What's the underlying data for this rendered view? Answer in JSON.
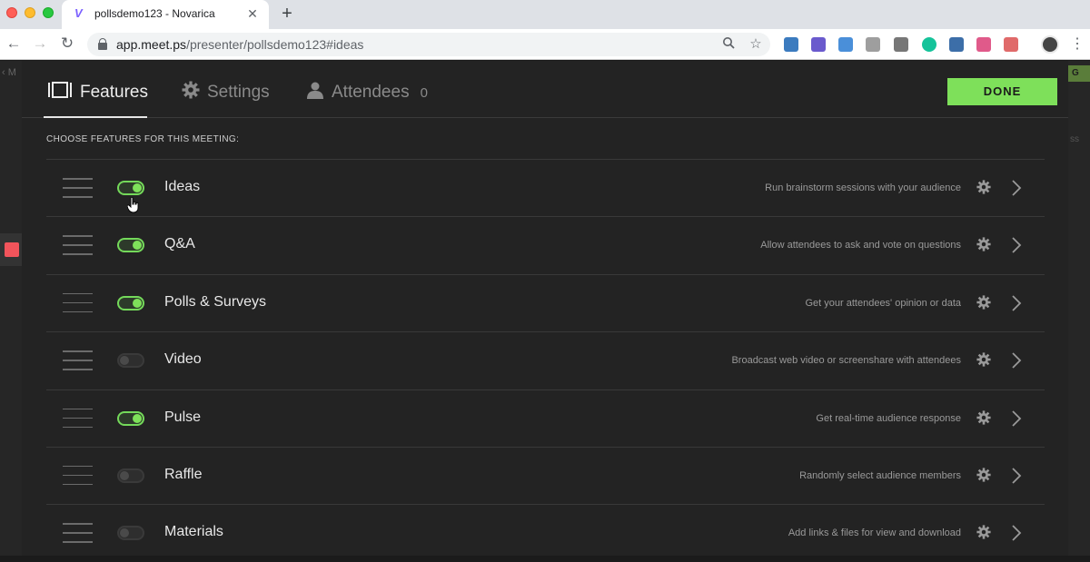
{
  "browser": {
    "tab_title": "pollsdemo123 - Novarica",
    "tab_favicon": "V",
    "url_host": "app.meet.ps",
    "url_path": "/presenter/pollsdemo123#ideas",
    "extensions": [
      {
        "name": "extension-1",
        "color": "#3b7bbf"
      },
      {
        "name": "extension-2",
        "color": "#6a5acd"
      },
      {
        "name": "extension-3",
        "color": "#4a8fd9"
      },
      {
        "name": "extension-4",
        "color": "#9e9e9e"
      },
      {
        "name": "extension-5",
        "color": "#777777"
      },
      {
        "name": "grammarly-extension",
        "color": "#15c39a"
      },
      {
        "name": "extension-7",
        "color": "#3c6ea8"
      },
      {
        "name": "extension-8",
        "color": "#e05a8a"
      },
      {
        "name": "extension-9",
        "color": "#e06a6a"
      }
    ]
  },
  "background": {
    "left_text": "‹ M",
    "right_badge": "G",
    "right_text": "ss"
  },
  "modal": {
    "tabs": {
      "features": "Features",
      "settings": "Settings",
      "attendees": "Attendees",
      "attendee_count": "0"
    },
    "done_label": "DONE",
    "section_label": "CHOOSE FEATURES FOR THIS MEETING:",
    "features": [
      {
        "name": "Ideas",
        "description": "Run brainstorm sessions with your audience",
        "enabled": true
      },
      {
        "name": "Q&A",
        "description": "Allow attendees to ask and vote on questions",
        "enabled": true
      },
      {
        "name": "Polls & Surveys",
        "description": "Get your attendees' opinion or data",
        "enabled": true
      },
      {
        "name": "Video",
        "description": "Broadcast web video or screenshare with attendees",
        "enabled": false
      },
      {
        "name": "Pulse",
        "description": "Get real-time audience response",
        "enabled": true
      },
      {
        "name": "Raffle",
        "description": "Randomly select audience members",
        "enabled": false
      },
      {
        "name": "Materials",
        "description": "Add links & files for view and download",
        "enabled": false
      }
    ]
  },
  "colors": {
    "accent_green": "#7ee05a",
    "modal_bg": "#232323",
    "record_red": "#f2545b"
  }
}
